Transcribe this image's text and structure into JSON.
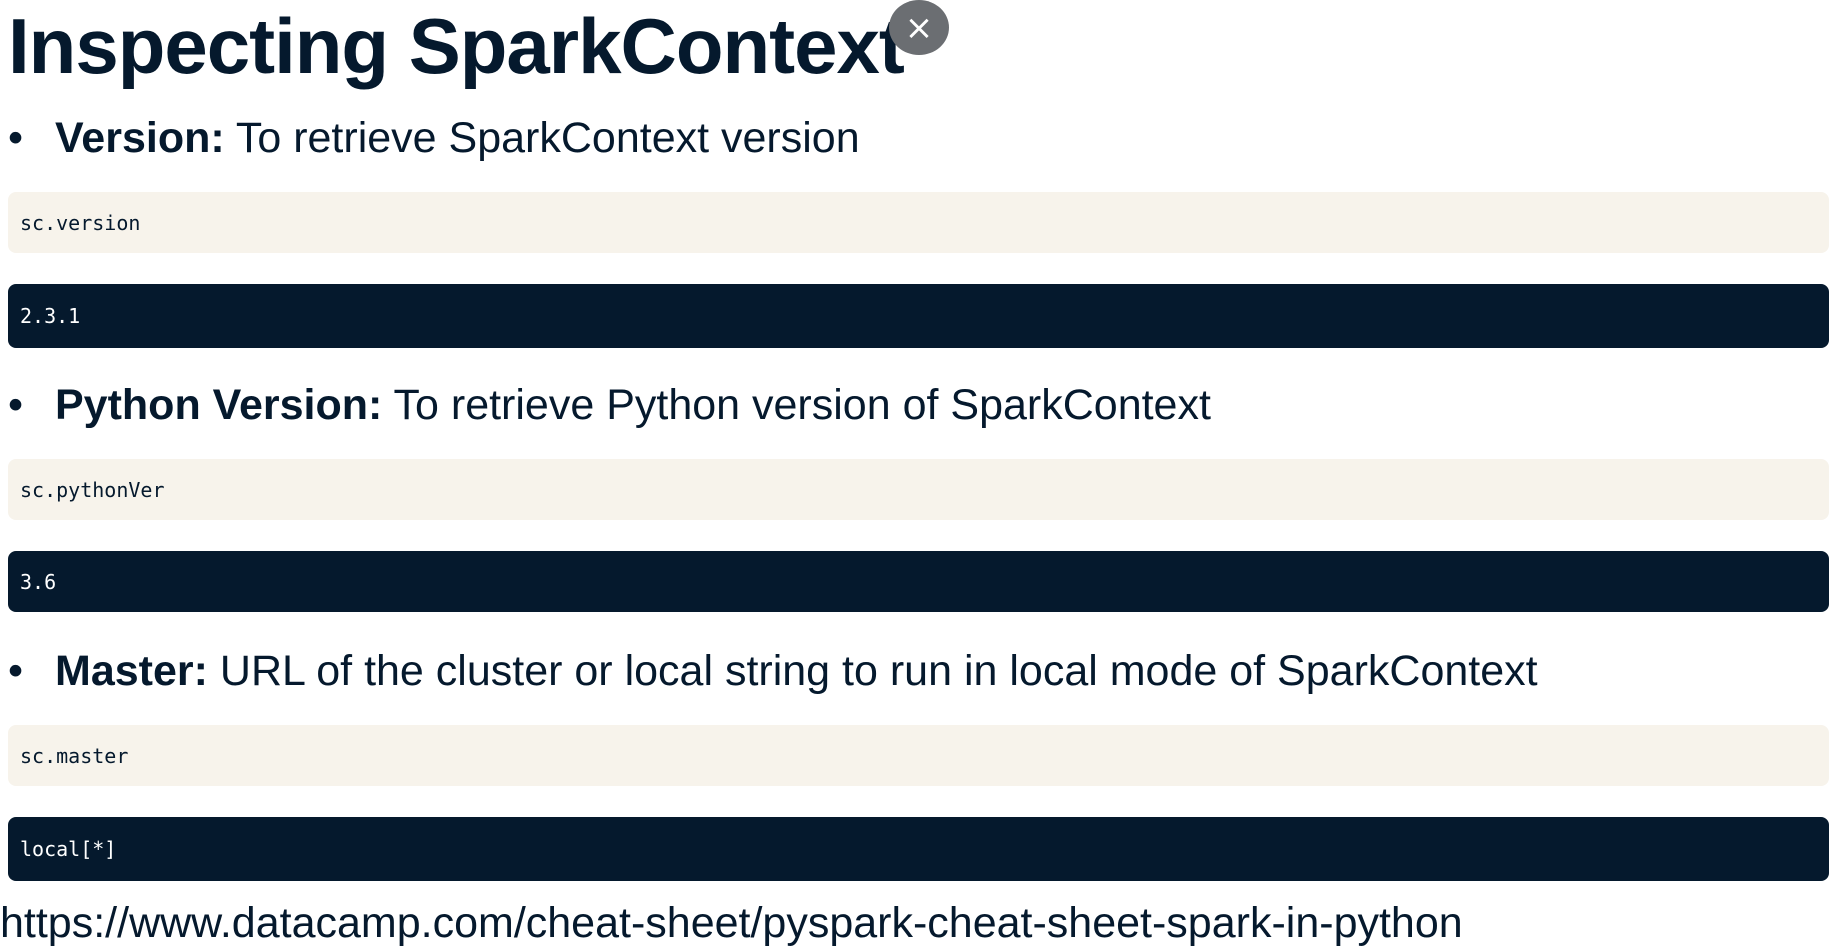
{
  "title": "Inspecting SparkContext",
  "close_symbol": "×",
  "items": [
    {
      "label": "Version:",
      "description": " To retrieve SparkContext version",
      "code": "sc.version",
      "output": "2.3.1"
    },
    {
      "label": "Python Version:",
      "description": " To retrieve Python version of SparkContext",
      "code": "sc.pythonVer",
      "output": "3.6"
    },
    {
      "label": "Master:",
      "description": " URL of the cluster or local string to run in local mode of SparkContext",
      "code": "sc.master",
      "output": "local[*]"
    }
  ],
  "source_url": "https://www.datacamp.com/cheat-sheet/pyspark-cheat-sheet-spark-in-python"
}
